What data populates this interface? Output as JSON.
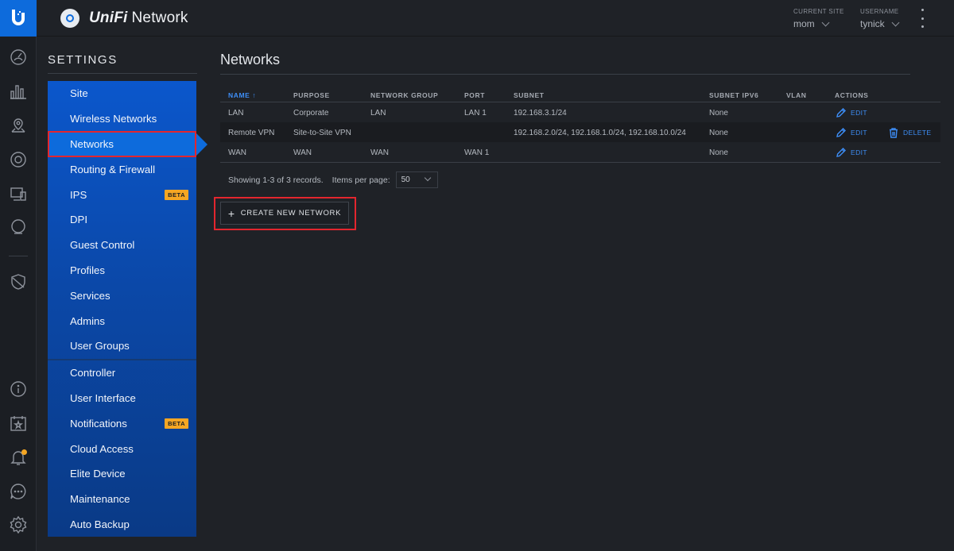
{
  "app": {
    "brand_mark": "UniFi",
    "brand_name": "Network",
    "colors": {
      "accent": "#0d6bdc",
      "highlight": "#e3262e",
      "beta": "#f5a623",
      "link": "#3d8df5"
    }
  },
  "rail": {
    "icons": [
      "ubiquiti-logo-icon",
      "dashboard-gauge-icon",
      "statistics-bars-icon",
      "map-pin-icon",
      "devices-circle-icon",
      "clients-monitor-icon",
      "insights-bulb-icon",
      "shield-icon",
      "info-icon",
      "events-calendar-icon",
      "alerts-bell-icon",
      "chat-icon",
      "settings-gear-icon"
    ]
  },
  "topbar": {
    "site_label": "CURRENT SITE",
    "site_value": "mom",
    "user_label": "USERNAME",
    "user_value": "tynick"
  },
  "settings": {
    "title": "SETTINGS",
    "beta_label": "BETA",
    "group1": [
      {
        "label": "Site"
      },
      {
        "label": "Wireless Networks"
      },
      {
        "label": "Networks"
      },
      {
        "label": "Routing & Firewall"
      },
      {
        "label": "IPS"
      },
      {
        "label": "DPI"
      },
      {
        "label": "Guest Control"
      },
      {
        "label": "Profiles"
      },
      {
        "label": "Services"
      },
      {
        "label": "Admins"
      },
      {
        "label": "User Groups"
      }
    ],
    "group2": [
      {
        "label": "Controller"
      },
      {
        "label": "User Interface"
      },
      {
        "label": "Notifications"
      },
      {
        "label": "Cloud Access"
      },
      {
        "label": "Elite Device"
      },
      {
        "label": "Maintenance"
      },
      {
        "label": "Auto Backup"
      }
    ]
  },
  "main": {
    "title": "Networks",
    "columns": {
      "name": "NAME",
      "purpose": "PURPOSE",
      "group": "NETWORK GROUP",
      "port": "PORT",
      "subnet": "SUBNET",
      "ipv6": "SUBNET IPV6",
      "vlan": "VLAN",
      "actions": "ACTIONS"
    },
    "rows": [
      {
        "name": "LAN",
        "purpose": "Corporate",
        "group": "LAN",
        "port": "LAN 1",
        "subnet": "192.168.3.1/24",
        "ipv6": "None",
        "vlan": ""
      },
      {
        "name": "Remote VPN",
        "purpose": "Site-to-Site VPN",
        "group": "",
        "port": "",
        "subnet": "192.168.2.0/24, 192.168.1.0/24, 192.168.10.0/24",
        "ipv6": "None",
        "vlan": ""
      },
      {
        "name": "WAN",
        "purpose": "WAN",
        "group": "WAN",
        "port": "WAN 1",
        "subnet": "",
        "ipv6": "None",
        "vlan": ""
      }
    ],
    "edit_label": "EDIT",
    "delete_label": "DELETE",
    "showing": "Showing 1-3 of 3 records.",
    "items_per_page_label": "Items per page:",
    "items_per_page_value": "50",
    "create_label": "CREATE NEW NETWORK"
  }
}
